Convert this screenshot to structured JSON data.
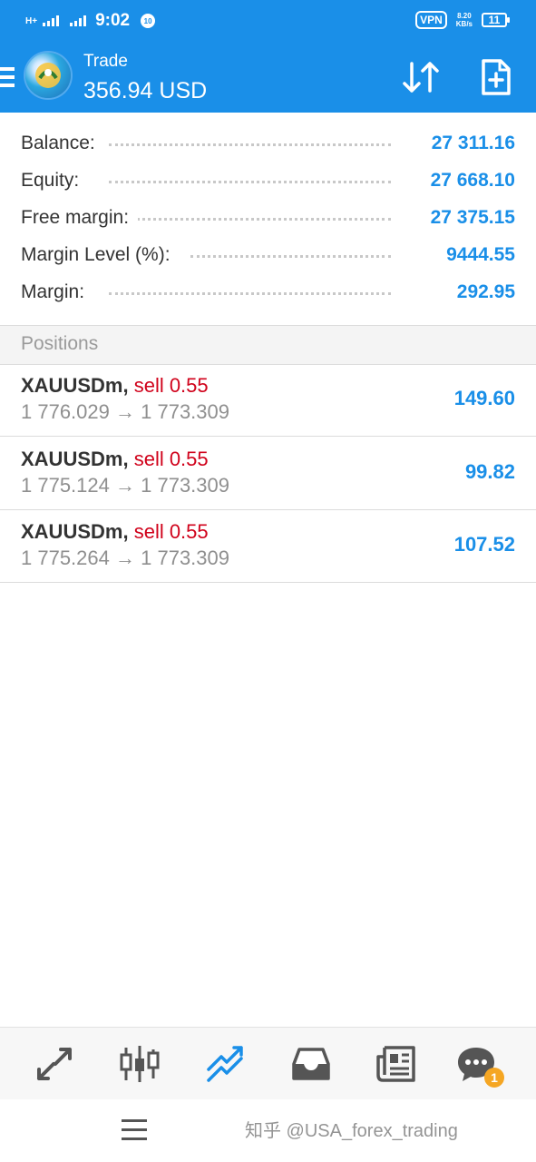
{
  "status_bar": {
    "network_label": "H+",
    "time": "9:02",
    "notification_badge": "10",
    "vpn_label": "VPN",
    "net_speed_value": "8.20",
    "net_speed_unit": "KB/s",
    "battery_level": "11"
  },
  "header": {
    "title": "Trade",
    "amount": "356.94 USD"
  },
  "summary": [
    {
      "label": "Balance:",
      "value": "27 311.16"
    },
    {
      "label": "Equity:",
      "value": "27 668.10"
    },
    {
      "label": "Free margin:",
      "value": "27 375.15"
    },
    {
      "label": "Margin Level (%):",
      "value": "9444.55"
    },
    {
      "label": "Margin:",
      "value": "292.95"
    }
  ],
  "positions_header": "Positions",
  "positions": [
    {
      "symbol": "XAUUSDm,",
      "side": "sell 0.55",
      "open_price": "1 776.029",
      "arrow": "→",
      "current_price": "1 773.309",
      "profit": "149.60"
    },
    {
      "symbol": "XAUUSDm,",
      "side": "sell 0.55",
      "open_price": "1 775.124",
      "arrow": "→",
      "current_price": "1 773.309",
      "profit": "99.82"
    },
    {
      "symbol": "XAUUSDm,",
      "side": "sell 0.55",
      "open_price": "1 775.264",
      "arrow": "→",
      "current_price": "1 773.309",
      "profit": "107.52"
    }
  ],
  "bottom_nav": {
    "chat_badge": "1"
  },
  "watermark": "知乎 @USA_forex_trading",
  "colors": {
    "header_bg": "#1a8fe8",
    "value_blue": "#1a8fe8",
    "sell_red": "#d0021b",
    "badge_orange": "#f5a623"
  }
}
